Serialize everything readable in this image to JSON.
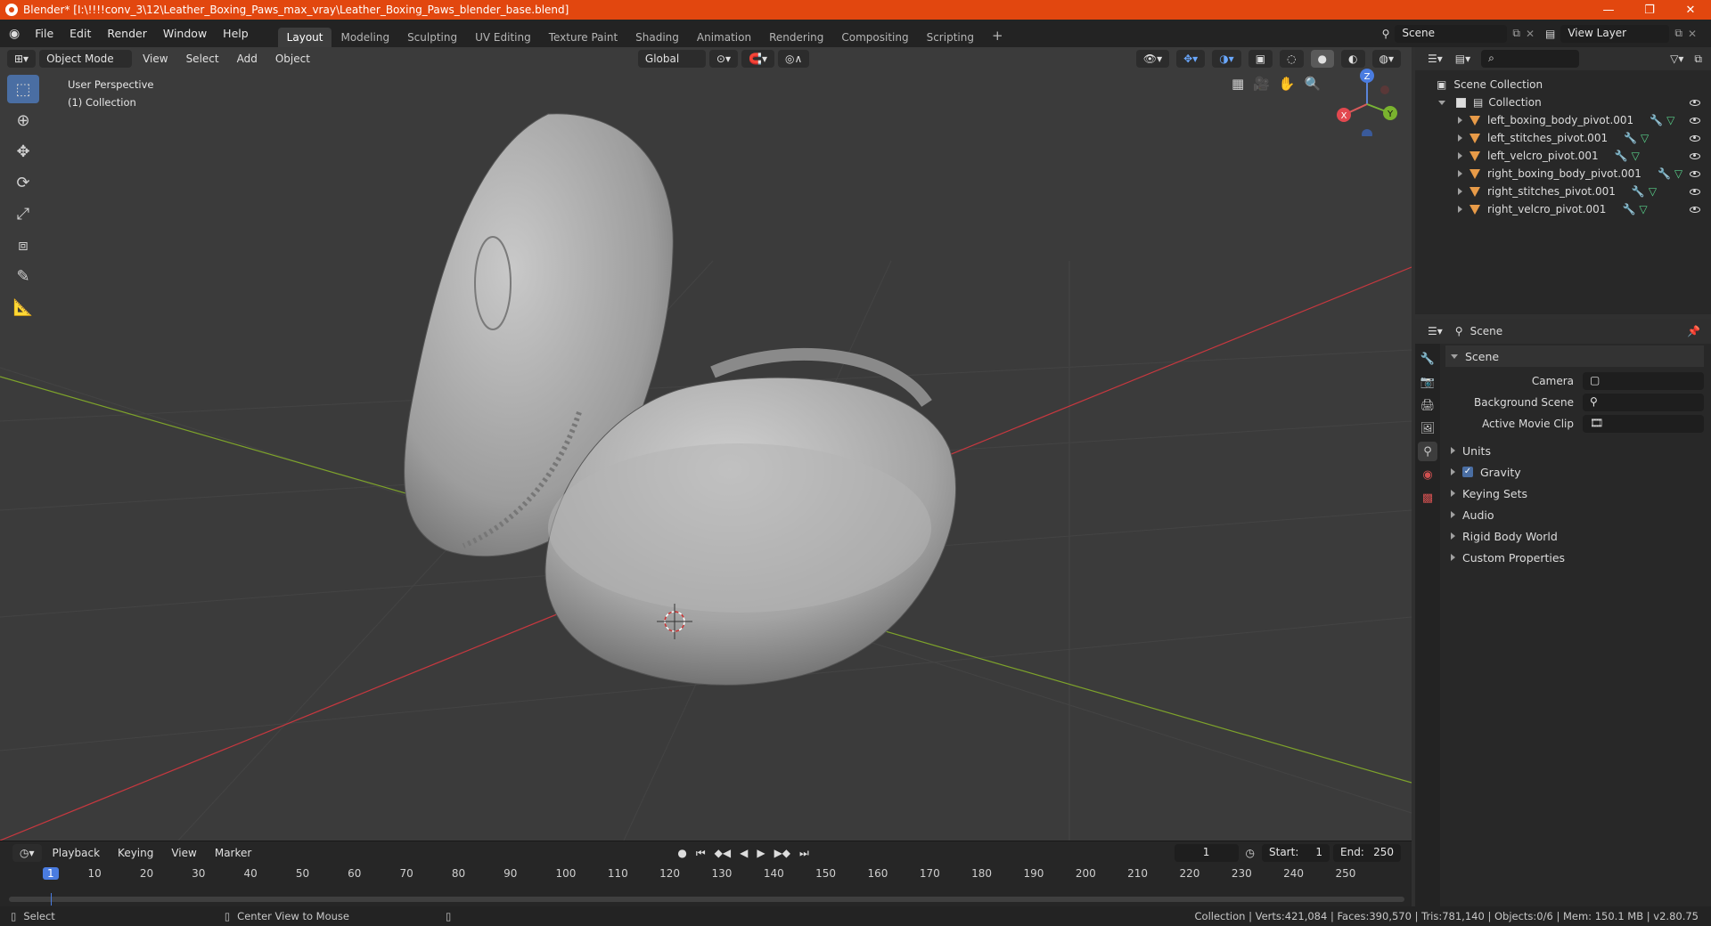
{
  "window": {
    "title": "Blender* [I:\\!!!!conv_3\\12\\Leather_Boxing_Paws_max_vray\\Leather_Boxing_Paws_blender_base.blend]",
    "minimize": "—",
    "maximize": "❐",
    "close": "✕"
  },
  "menu": [
    "File",
    "Edit",
    "Render",
    "Window",
    "Help"
  ],
  "workspaces": [
    "Layout",
    "Modeling",
    "Sculpting",
    "UV Editing",
    "Texture Paint",
    "Shading",
    "Animation",
    "Rendering",
    "Compositing",
    "Scripting"
  ],
  "workspace_add": "+",
  "scene_field": "Scene",
  "view_layer_field": "View Layer",
  "viewport": {
    "mode": "Object Mode",
    "header_menu": [
      "View",
      "Select",
      "Add",
      "Object"
    ],
    "transform_orientation": "Global",
    "perspective": "User Perspective",
    "collection": "(1) Collection",
    "gizmo": {
      "x": "X",
      "y": "Y",
      "z": "Z"
    }
  },
  "outliner": {
    "search_placeholder": "",
    "root": "Scene Collection",
    "collection": "Collection",
    "objects": [
      "left_boxing_body_pivot.001",
      "left_stitches_pivot.001",
      "left_velcro_pivot.001",
      "right_boxing_body_pivot.001",
      "right_stitches_pivot.001",
      "right_velcro_pivot.001"
    ]
  },
  "properties": {
    "header": "Scene",
    "section": "Scene",
    "fields": [
      {
        "label": "Camera",
        "value": ""
      },
      {
        "label": "Background Scene",
        "value": ""
      },
      {
        "label": "Active Movie Clip",
        "value": ""
      }
    ],
    "panels": [
      "Units",
      "Gravity",
      "Keying Sets",
      "Audio",
      "Rigid Body World",
      "Custom Properties"
    ],
    "gravity_checked": true
  },
  "timeline": {
    "menu": [
      "Playback",
      "Keying",
      "View",
      "Marker"
    ],
    "current_frame": "1",
    "start_label": "Start:",
    "start": "1",
    "end_label": "End:",
    "end": "250",
    "ruler": [
      "1",
      "10",
      "20",
      "30",
      "40",
      "50",
      "60",
      "70",
      "80",
      "90",
      "100",
      "110",
      "120",
      "130",
      "140",
      "150",
      "160",
      "170",
      "180",
      "190",
      "200",
      "210",
      "220",
      "230",
      "240",
      "250"
    ]
  },
  "statusbar": {
    "select": "Select",
    "center_view": "Center View to Mouse",
    "stats": "Collection | Verts:421,084 | Faces:390,570 | Tris:781,140 | Objects:0/6 | Mem: 150.1 MB | v2.80.75"
  },
  "colors": {
    "titlebar": "#e2470f",
    "accent": "#4a6ea3",
    "axis_x": "#c8383f",
    "axis_y": "#7ea32b"
  }
}
